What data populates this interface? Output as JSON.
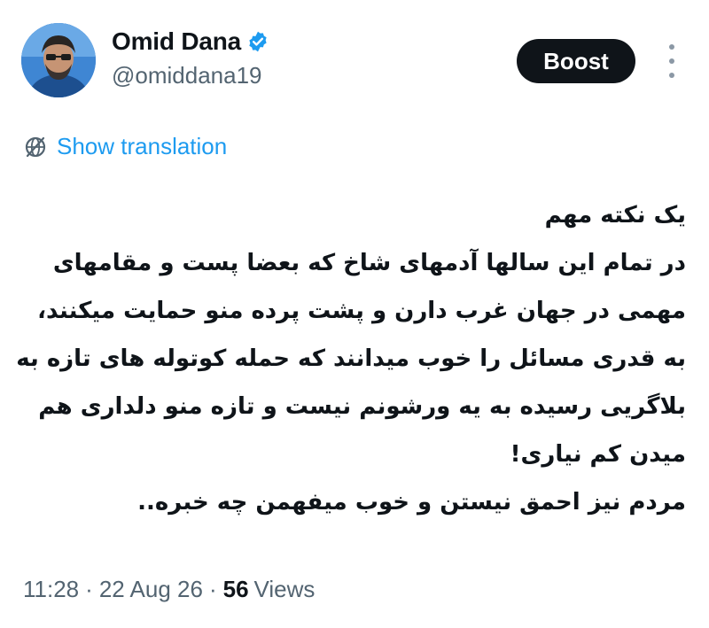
{
  "author": {
    "display_name": "Omid Dana",
    "handle": "@omiddana19",
    "verified_icon": "verified-badge-icon",
    "verified_color": "#1d9bf0"
  },
  "actions": {
    "boost_label": "Boost",
    "more_icon": "more-vertical-icon"
  },
  "translation": {
    "icon": "globe-icon",
    "label": "Show translation",
    "color": "#1d9bf0"
  },
  "tweet": {
    "lines": [
      "یک نکته مهم",
      "در تمام این سالها آدمهای شاخ که بعضا پست و مقامهای",
      "مهمی در جهان غرب دارن و پشت پرده منو حمایت میکنند،",
      "به قدری مسائل را خوب میدانند که حمله کوتوله های تازه به",
      "بلاگریی رسیده به یه ورشونم نیست و تازه منو دلداری هم",
      "میدن کم نیاری!",
      "مردم نیز احمق نیستن و خوب میفهمن چه خبره.."
    ]
  },
  "meta": {
    "time": "11:28",
    "separator": "·",
    "date": "22 Aug 26",
    "views_count": "56",
    "views_label": "Views"
  }
}
